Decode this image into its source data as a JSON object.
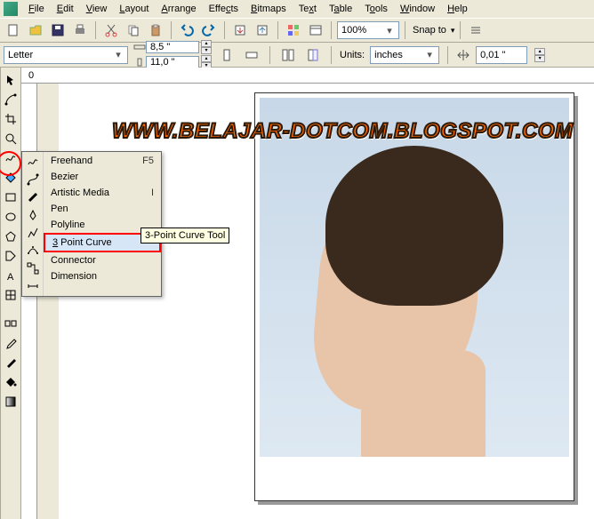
{
  "menu": {
    "items": [
      "File",
      "Edit",
      "View",
      "Layout",
      "Arrange",
      "Effects",
      "Bitmaps",
      "Text",
      "Table",
      "Tools",
      "Window",
      "Help"
    ]
  },
  "toolbar": {
    "zoom": "100%",
    "snap": "Snap to"
  },
  "propbar": {
    "page_preset": "Letter",
    "width": "8,5 \"",
    "height": "11,0 \"",
    "units_label": "Units:",
    "units_value": "inches",
    "nudge": "0,01 \""
  },
  "flyout": {
    "items": [
      {
        "label": "Freehand",
        "shortcut": "F5"
      },
      {
        "label": "Bezier",
        "shortcut": ""
      },
      {
        "label": "Artistic Media",
        "shortcut": "I"
      },
      {
        "label": "Pen",
        "shortcut": ""
      },
      {
        "label": "Polyline",
        "shortcut": ""
      },
      {
        "label": "3 Point Curve",
        "shortcut": ""
      },
      {
        "label": "Connector",
        "shortcut": ""
      },
      {
        "label": "Dimension",
        "shortcut": ""
      }
    ],
    "selected_index": 5,
    "tooltip": "3-Point Curve Tool"
  },
  "ruler": {
    "mark": "0"
  },
  "watermark": "WWW.BELAJAR-DOTCOM.BLOGSPOT.COM"
}
